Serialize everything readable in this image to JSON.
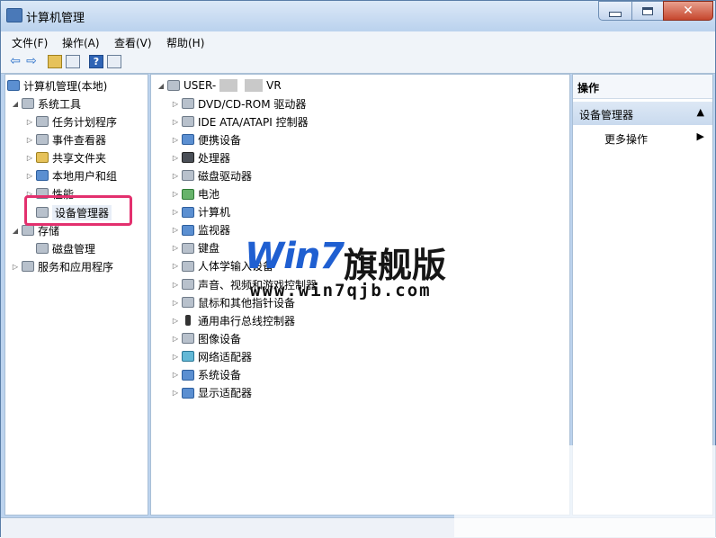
{
  "window": {
    "title": "计算机管理",
    "close_glyph": "✕"
  },
  "menu": [
    "文件(F)",
    "操作(A)",
    "查看(V)",
    "帮助(H)"
  ],
  "toolbar": {
    "back_glyph": "⇦",
    "forward_glyph": "⇨",
    "help_glyph": "?"
  },
  "left_tree": {
    "root": "计算机管理(本地)",
    "system_tools": "系统工具",
    "task_scheduler": "任务计划程序",
    "event_viewer": "事件查看器",
    "shared_folders": "共享文件夹",
    "local_users": "本地用户和组",
    "performance": "性能",
    "device_manager": "设备管理器",
    "storage": "存储",
    "disk_management": "磁盘管理",
    "services_apps": "服务和应用程序"
  },
  "device_tree": {
    "root_prefix": "USER-",
    "root_suffix": "VR",
    "items": [
      {
        "label": "DVD/CD-ROM 驱动器",
        "icon": "dvd-drive-icon"
      },
      {
        "label": "IDE ATA/ATAPI 控制器",
        "icon": "ide-controller-icon"
      },
      {
        "label": "便携设备",
        "icon": "portable-device-icon"
      },
      {
        "label": "处理器",
        "icon": "processor-icon"
      },
      {
        "label": "磁盘驱动器",
        "icon": "disk-drive-icon"
      },
      {
        "label": "电池",
        "icon": "battery-icon"
      },
      {
        "label": "计算机",
        "icon": "computer-icon"
      },
      {
        "label": "监视器",
        "icon": "monitor-icon"
      },
      {
        "label": "键盘",
        "icon": "keyboard-icon"
      },
      {
        "label": "人体学输入设备",
        "icon": "hid-icon"
      },
      {
        "label": "声音、视频和游戏控制器",
        "icon": "sound-icon"
      },
      {
        "label": "鼠标和其他指针设备",
        "icon": "mouse-icon"
      },
      {
        "label": "通用串行总线控制器",
        "icon": "usb-icon"
      },
      {
        "label": "图像设备",
        "icon": "imaging-device-icon"
      },
      {
        "label": "网络适配器",
        "icon": "network-adapter-icon"
      },
      {
        "label": "系统设备",
        "icon": "system-device-icon"
      },
      {
        "label": "显示适配器",
        "icon": "display-adapter-icon"
      }
    ]
  },
  "actions": {
    "header": "操作",
    "section": "设备管理器",
    "section_caret": "▲",
    "more": "更多操作",
    "more_caret": "▶"
  },
  "watermark": {
    "brand": "Win7",
    "name": "旗舰版",
    "url": "www.win7qjb.com"
  },
  "colors": {
    "highlight_border": "#e3306e",
    "watermark_blue": "#1f5fd1"
  }
}
